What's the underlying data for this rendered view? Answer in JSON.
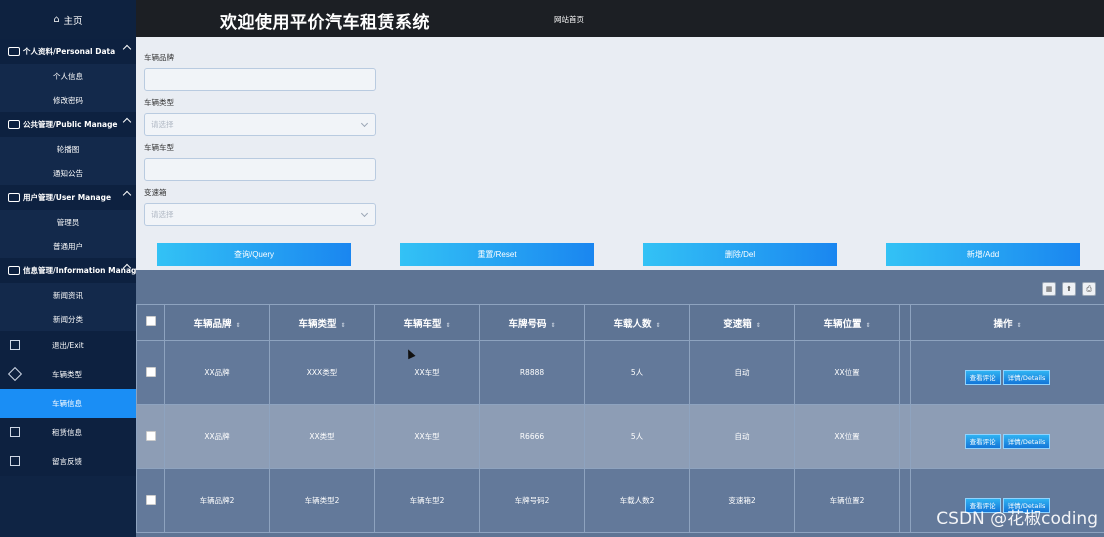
{
  "sidebar": {
    "home": "主页",
    "groups": [
      {
        "label": "个人资料/Personal Data",
        "items": [
          "个人信息",
          "修改密码"
        ]
      },
      {
        "label": "公共管理/Public Manage",
        "items": [
          "轮播图",
          "通知公告"
        ]
      },
      {
        "label": "用户管理/User Manage",
        "items": [
          "管理员",
          "普通用户"
        ]
      },
      {
        "label": "信息管理/Information Manage",
        "items": [
          "新闻资讯",
          "新闻分类"
        ]
      }
    ],
    "items": [
      {
        "label": "退出/Exit",
        "active": false
      },
      {
        "label": "车辆类型",
        "active": false
      },
      {
        "label": "车辆信息",
        "active": true
      },
      {
        "label": "租赁信息",
        "active": false
      },
      {
        "label": "留言反馈",
        "active": false
      }
    ]
  },
  "header": {
    "title": "欢迎使用平价汽车租赁系统",
    "site_link": "网站首页"
  },
  "search": {
    "fields": [
      {
        "label": "车辆品牌",
        "value": "",
        "placeholder": "",
        "type": "input"
      },
      {
        "label": "车辆类型",
        "value": "请选择",
        "type": "select"
      },
      {
        "label": "车辆车型",
        "value": "",
        "placeholder": "",
        "type": "input"
      },
      {
        "label": "变速箱",
        "value": "请选择",
        "type": "select"
      }
    ],
    "buttons": [
      "查询/Query",
      "重置/Reset",
      "删除/Del",
      "新增/Add"
    ]
  },
  "table": {
    "columns": [
      "车辆品牌",
      "车辆类型",
      "车辆车型",
      "车牌号码",
      "车载人数",
      "变速箱",
      "车辆位置",
      "操作"
    ],
    "rows": [
      [
        "XX品牌",
        "XXX类型",
        "XX车型",
        "R8888",
        "5人",
        "自动",
        "XX位置"
      ],
      [
        "XX品牌",
        "XX类型",
        "XX车型",
        "R6666",
        "5人",
        "自动",
        "XX位置"
      ],
      [
        "车辆品牌2",
        "车辆类型2",
        "车辆车型2",
        "车牌号码2",
        "车载人数2",
        "变速箱2",
        "车辆位置2"
      ]
    ],
    "actions": [
      "查看评论",
      "详情/Details"
    ]
  },
  "watermark": "CSDN @花椒coding",
  "colors": {
    "sidebar_bg": "#0f2444",
    "active_blue": "#1a8ef5",
    "header_bg": "#1c1f24",
    "table_bg": "#5e7494",
    "button_gradient_start": "#33c2f5",
    "button_gradient_end": "#1a86f0"
  }
}
